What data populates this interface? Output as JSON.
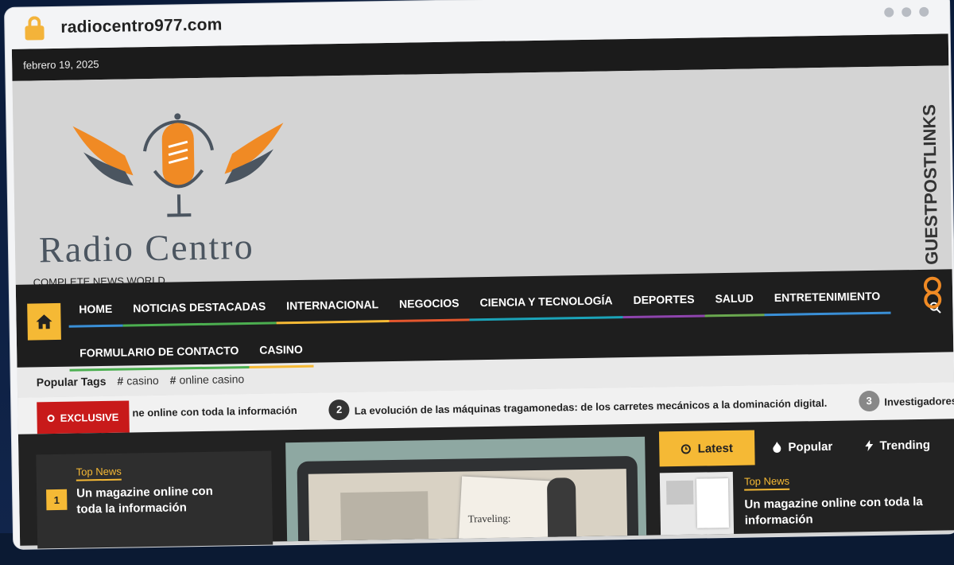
{
  "browser": {
    "url": "radiocentro977.com"
  },
  "topbar": {
    "date": "febrero 19, 2025"
  },
  "site": {
    "name": "Radio Centro",
    "tagline": "COMPLETE NEWS WORLD"
  },
  "nav": {
    "items": [
      {
        "label": "HOME",
        "color": "#3a8fd6"
      },
      {
        "label": "NOTICIAS DESTACADAS",
        "color": "#4caf50"
      },
      {
        "label": "INTERNACIONAL",
        "color": "#f5b935"
      },
      {
        "label": "NEGOCIOS",
        "color": "#e4572e"
      },
      {
        "label": "CIENCIA Y TECNOLOGÍA",
        "color": "#1ba3b8"
      },
      {
        "label": "DEPORTES",
        "color": "#8e44ad"
      },
      {
        "label": "SALUD",
        "color": "#6aa84f"
      },
      {
        "label": "ENTRETENIMIENTO",
        "color": "#3a8fd6"
      },
      {
        "label": "FORMULARIO DE CONTACTO",
        "color": "#4caf50"
      },
      {
        "label": "CASINO",
        "color": "#f5b935"
      }
    ]
  },
  "tags": {
    "label": "Popular Tags",
    "items": [
      "casino",
      "online casino"
    ]
  },
  "ticker": {
    "badge": "EXCLUSIVE",
    "items": [
      {
        "num": "",
        "text": "ne online con toda la información"
      },
      {
        "num": "2",
        "text": "La evolución de las máquinas tragamonedas: de los carretes mecánicos a la dominación digital."
      },
      {
        "num": "3",
        "text": "Investigadores de la UC"
      }
    ]
  },
  "left_card": {
    "kicker": "Top News",
    "rank": "1",
    "title": "Un magazine online con toda la información"
  },
  "feature": {
    "caption": "Traveling:"
  },
  "sidebar": {
    "tabs": [
      {
        "label": "Latest",
        "icon": "clock-icon"
      },
      {
        "label": "Popular",
        "icon": "fire-icon"
      },
      {
        "label": "Trending",
        "icon": "bolt-icon"
      }
    ],
    "latest": {
      "kicker": "Top News",
      "title": "Un magazine online con toda la información"
    }
  },
  "watermark": {
    "text": "GUESTPOSTLINKS"
  },
  "colors": {
    "accent": "#f5b935",
    "exclusive": "#c81a1a",
    "nav_bg": "#1e1e1e"
  }
}
